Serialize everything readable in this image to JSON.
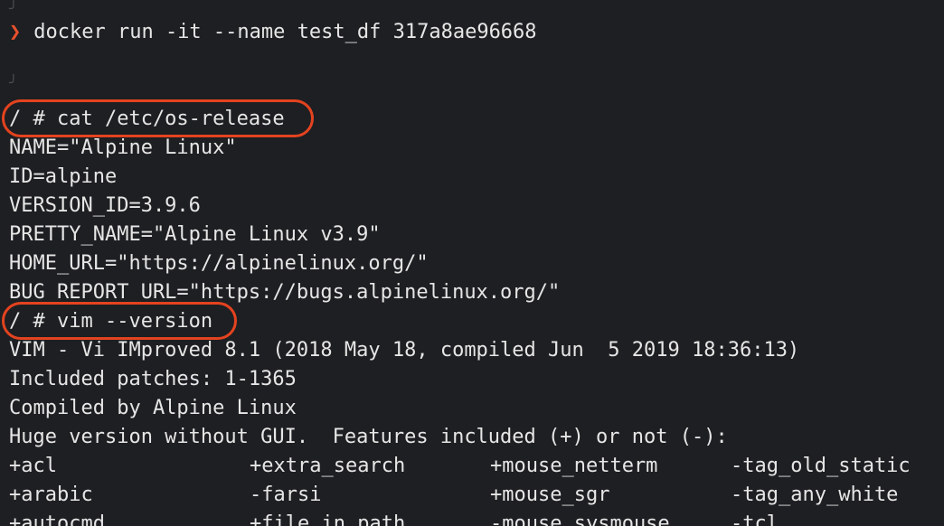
{
  "colors": {
    "background": "#1e1f22",
    "text": "#e6e6e6",
    "prompt_arrow": "#e8512e",
    "highlight_outline": "#e4431f"
  },
  "icons": {
    "prompt": "chevron-right-icon",
    "corner": "prompt-corner-glyph"
  },
  "prompt_symbol": "❯",
  "corner_glyph": "╯",
  "host_command": "docker run -it --name test_df 317a8ae96668",
  "shell_commands": [
    "/ # cat /etc/os-release",
    "/ # vim --version"
  ],
  "os_release": [
    "NAME=\"Alpine Linux\"",
    "ID=alpine",
    "VERSION_ID=3.9.6",
    "PRETTY_NAME=\"Alpine Linux v3.9\"",
    "HOME_URL=\"https://alpinelinux.org/\"",
    "BUG_REPORT_URL=\"https://bugs.alpinelinux.org/\""
  ],
  "vim_version": [
    "VIM - Vi IMproved 8.1 (2018 May 18, compiled Jun  5 2019 18:36:13)",
    "Included patches: 1-1365",
    "Compiled by Alpine Linux",
    "Huge version without GUI.  Features included (+) or not (-):"
  ],
  "features": [
    [
      "+acl",
      "+extra_search",
      "+mouse_netterm",
      "-tag_old_static"
    ],
    [
      "+arabic",
      "-farsi",
      "+mouse_sgr",
      "-tag_any_white"
    ],
    [
      "+autocmd",
      "+file_in_path",
      "-mouse_sysmouse",
      "-tcl"
    ]
  ]
}
